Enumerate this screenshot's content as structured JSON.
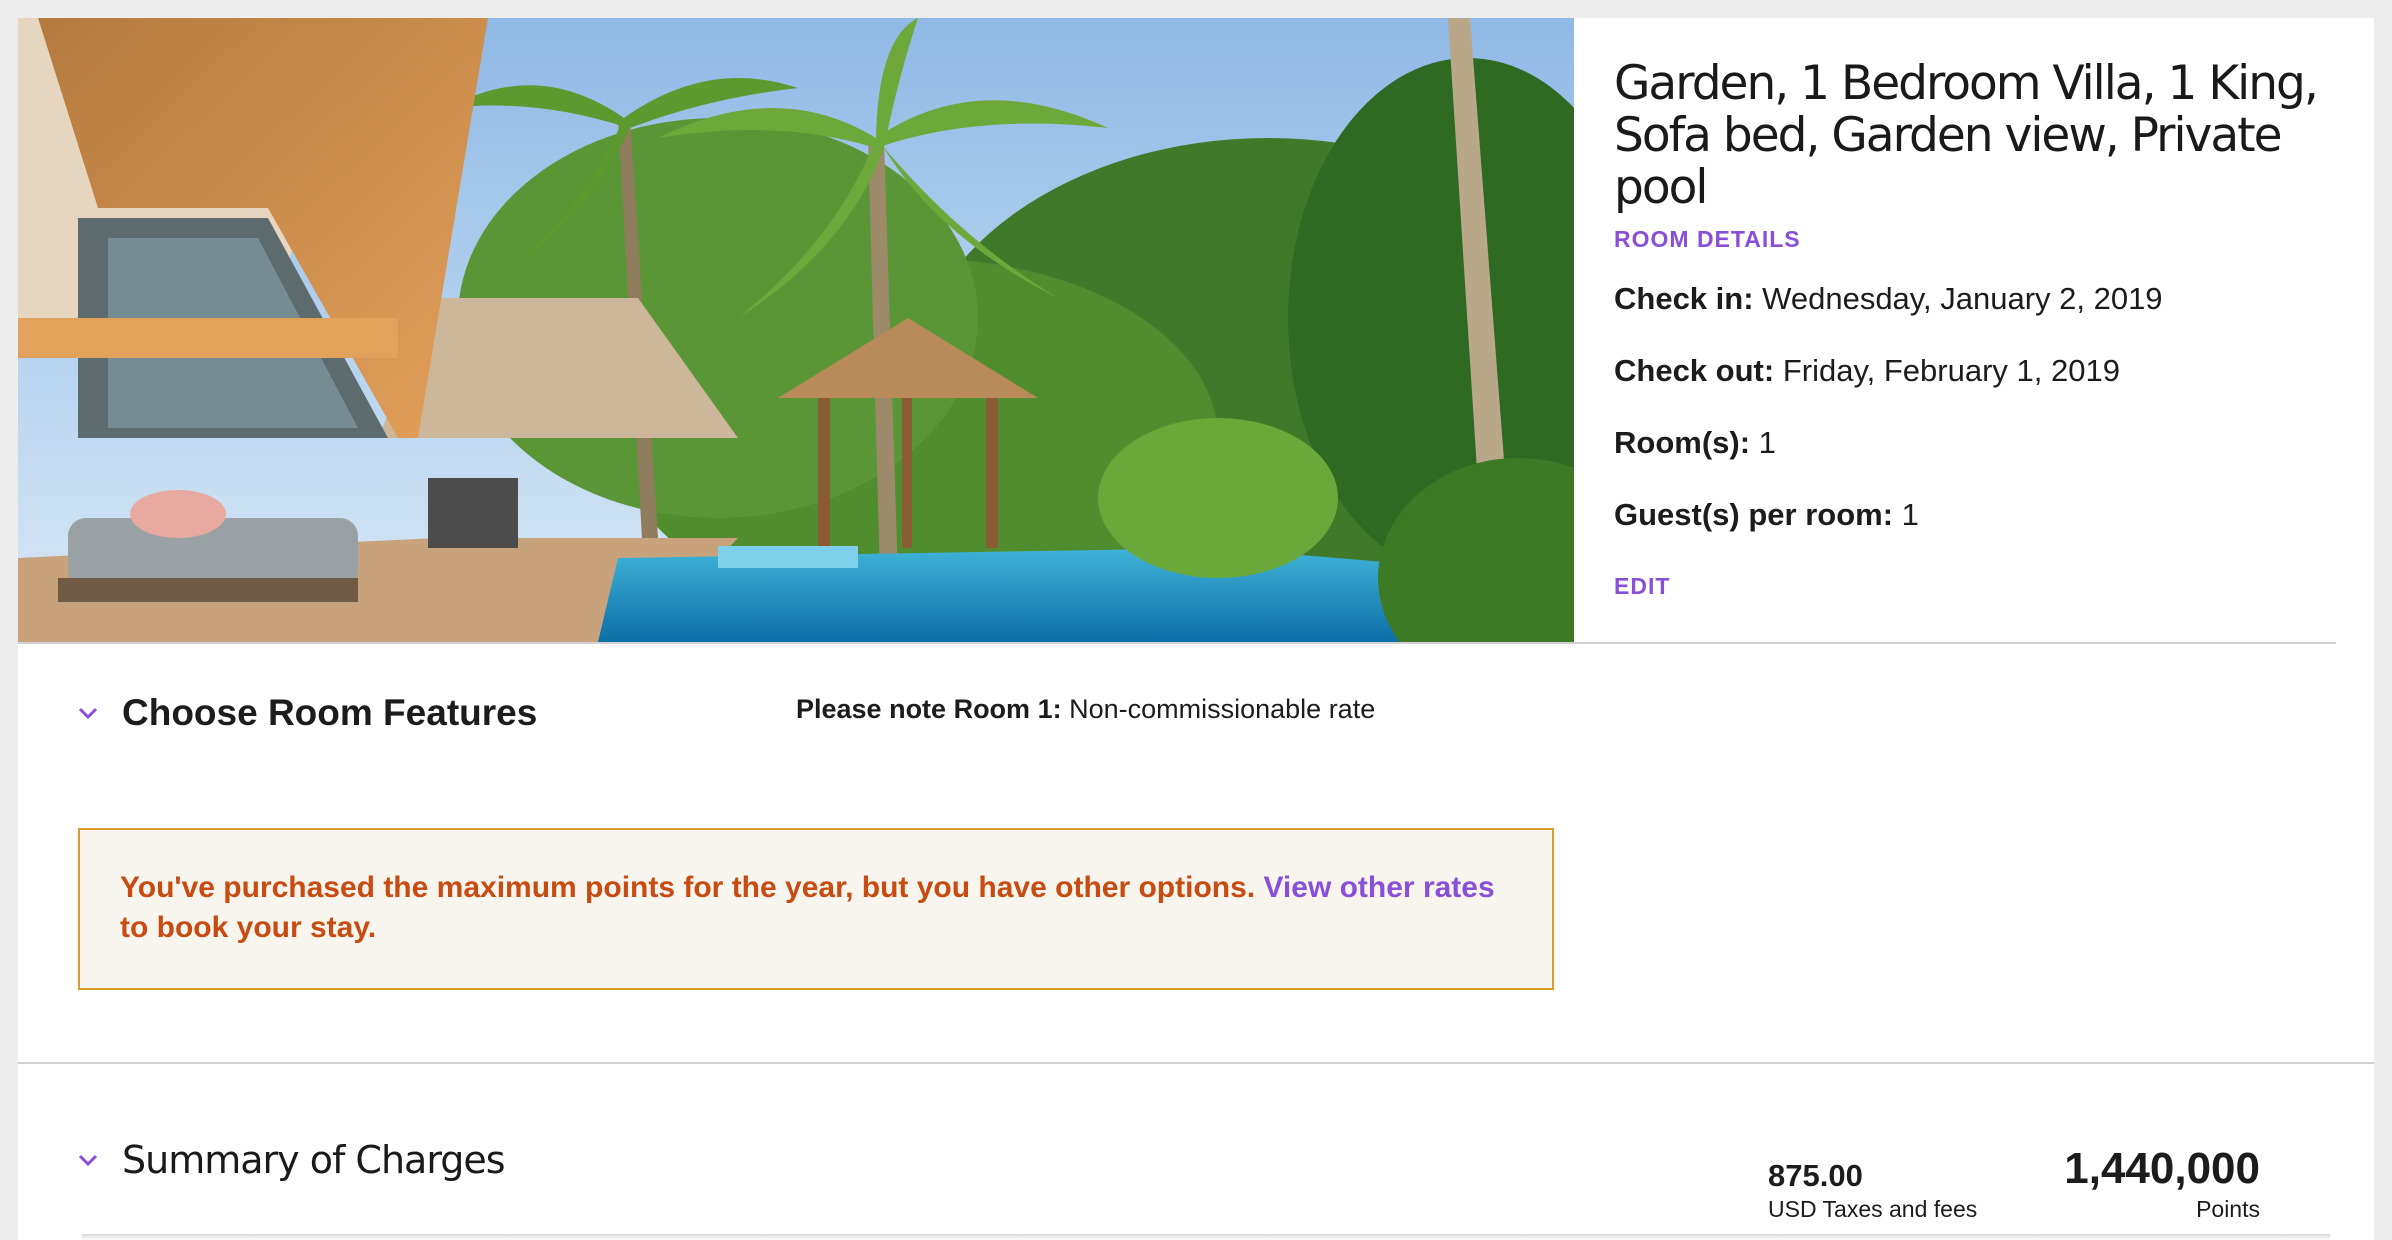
{
  "hero": {
    "image": "villa-with-private-pool-and-palm-trees"
  },
  "room": {
    "title": "Garden, 1 Bedroom Villa, 1 King, Sofa bed, Garden view, Private pool",
    "details_link": "ROOM DETAILS",
    "check_in_label": "Check in:",
    "check_in_value": "Wednesday, January 2, 2019",
    "check_out_label": "Check out:",
    "check_out_value": "Friday, February 1, 2019",
    "rooms_label": "Room(s):",
    "rooms_value": "1",
    "guests_label": "Guest(s) per room:",
    "guests_value": "1",
    "edit_link": "EDIT"
  },
  "features": {
    "title": "Choose Room Features",
    "note_label": "Please note Room 1:",
    "note_value": "Non-commissionable rate"
  },
  "alert": {
    "text_before": "You've purchased the maximum points for the year, but you have other options. ",
    "link_text": "View other rates",
    "text_after": " to book your stay."
  },
  "summary": {
    "title": "Summary of Charges",
    "taxes_amount": "875.00",
    "taxes_label": "USD Taxes and fees",
    "points_amount": "1,440,000",
    "points_label": "Points"
  },
  "colors": {
    "accent": "#8a4fd8",
    "alert_text": "#c84b11",
    "alert_border": "#dc9a2a",
    "alert_bg": "#f8f5ee"
  }
}
